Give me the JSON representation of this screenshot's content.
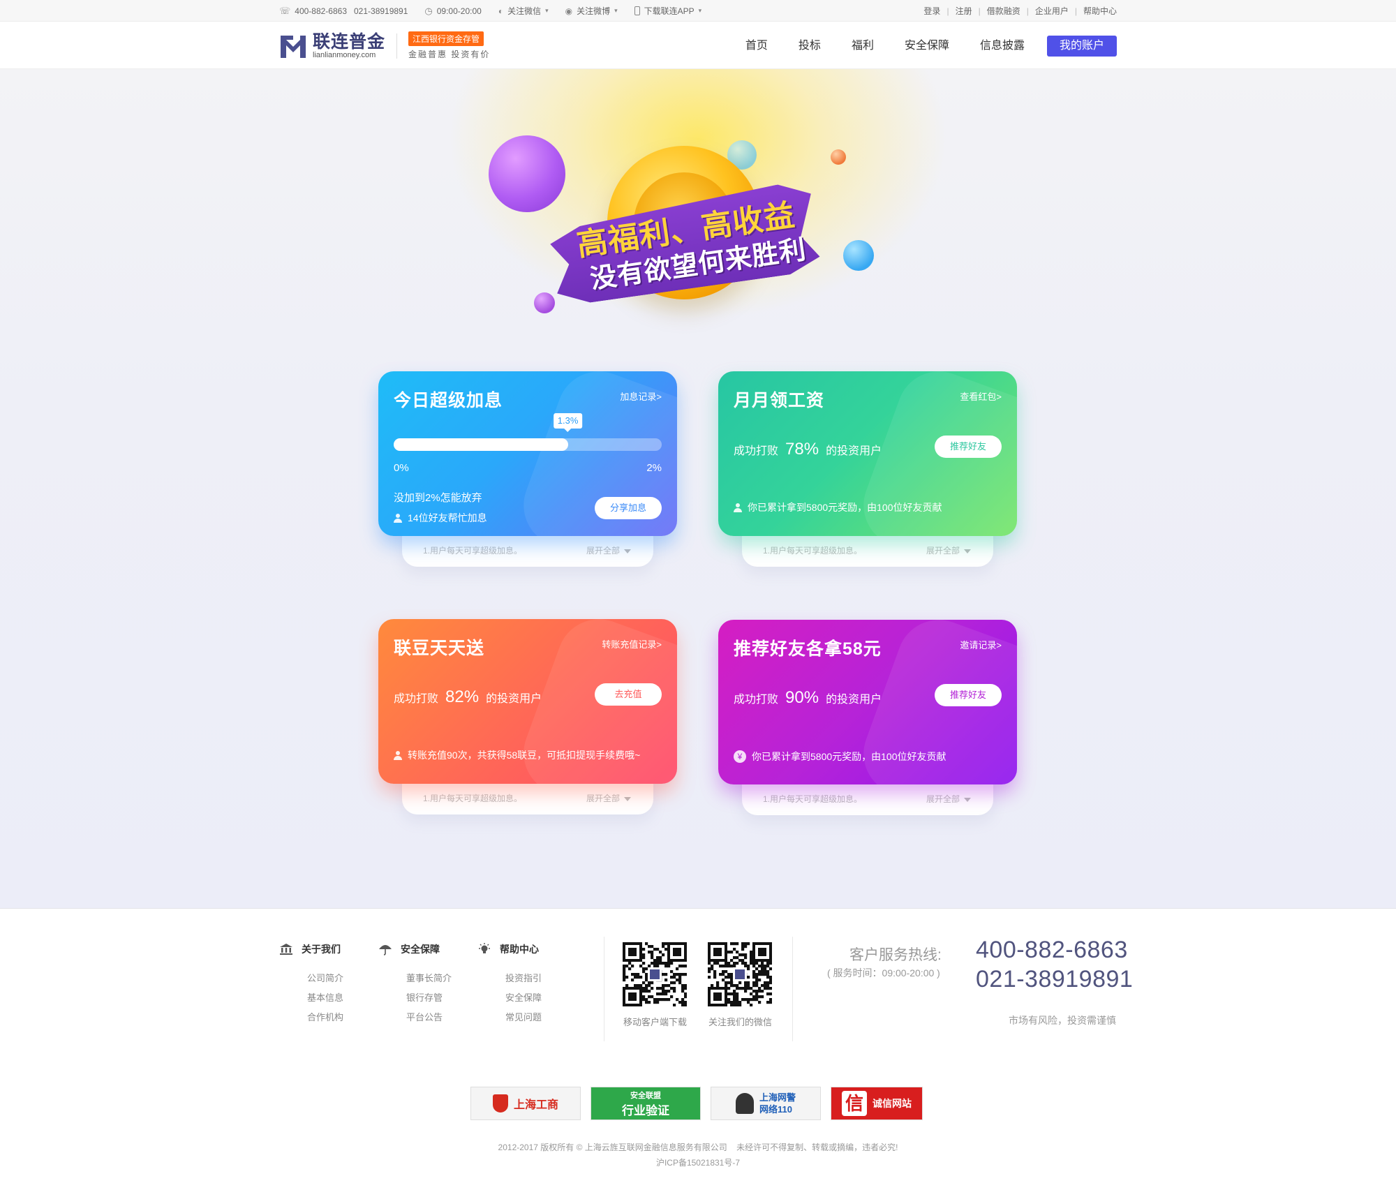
{
  "topbar": {
    "phones": "400-882-6863   021-38919891",
    "hours": "09:00-20:00",
    "wechat": "关注微信",
    "weibo": "关注微博",
    "app": "下载联连APP",
    "links": [
      "登录",
      "注册",
      "借款融资",
      "企业用户",
      "帮助中心"
    ]
  },
  "header": {
    "logo_cn": "联连普金",
    "logo_en": "lianlianmoney.com",
    "badge": "江西银行资金存管",
    "slogan": "金融普惠 投资有价",
    "nav": [
      "首页",
      "投标",
      "福利",
      "安全保障",
      "信息披露"
    ],
    "account": "我的账户"
  },
  "hero": {
    "line1": "高福利、高收益",
    "line2": "没有欲望何来胜利"
  },
  "cards": {
    "c1": {
      "title": "今日超级加息",
      "link": "加息记录>",
      "progress": 0.65,
      "tip": "1.3%",
      "min": "0%",
      "max": "2%",
      "msg": "没加到2%怎能放弃",
      "foot": "14位好友帮忙加息",
      "button": "分享加息",
      "sheet_text": "1.用户每天可享超级加息。",
      "sheet_more": "展开全部"
    },
    "c2": {
      "title": "月月领工资",
      "link": "查看红包>",
      "rate_pre": "成功打败",
      "rate": "78%",
      "rate_post": "的投资用户",
      "button": "推荐好友",
      "foot": "你已累计拿到5800元奖励，由100位好友贡献",
      "sheet_text": "1.用户每天可享超级加息。",
      "sheet_more": "展开全部"
    },
    "c3": {
      "title": "联豆天天送",
      "link": "转账充值记录>",
      "rate_pre": "成功打败",
      "rate": "82%",
      "rate_post": "的投资用户",
      "button": "去充值",
      "foot": "转账充值90次，共获得58联豆，可抵扣提现手续费哦~",
      "sheet_text": "1.用户每天可享超级加息。",
      "sheet_more": "展开全部"
    },
    "c4": {
      "title": "推荐好友各拿58元",
      "link": "邀请记录>",
      "rate_pre": "成功打败",
      "rate": "90%",
      "rate_post": "的投资用户",
      "button": "推荐好友",
      "foot": "你已累计拿到5800元奖励，由100位好友贡献",
      "sheet_text": "1.用户每天可享超级加息。",
      "sheet_more": "展开全部"
    }
  },
  "footer": {
    "col1": {
      "title": "关于我们",
      "links": [
        "公司简介",
        "基本信息",
        "合作机构"
      ]
    },
    "col2": {
      "title": "安全保障",
      "links": [
        "董事长简介",
        "银行存管",
        "平台公告"
      ]
    },
    "col3": {
      "title": "帮助中心",
      "links": [
        "投资指引",
        "安全保障",
        "常见问题"
      ]
    },
    "qr1": "移动客户端下载",
    "qr2": "关注我们的微信",
    "hotline_label": "客户服务热线:",
    "hotline_time": "( 服务时间：09:00-20:00 )",
    "hotline1": "400-882-6863",
    "hotline2": "021-38919891",
    "risk": "市场有风险，投资需谨慎",
    "badge1": "上海工商",
    "badge2a": "安全联盟",
    "badge2b": "行业验证",
    "badge3a": "上海网警",
    "badge3b": "网络110",
    "badge4a": "信",
    "badge4b": "诚信网站",
    "copyright": "2012-2017 版权所有 © 上海云旌互联网金融信息服务有限公司    未经许可不得复制、转载或摘编，违者必究!",
    "icp": "沪ICP备15021831号-7"
  },
  "colors": {
    "brand": "#3b3f76",
    "accent": "#5051e8",
    "badge": "#ff6a13"
  }
}
